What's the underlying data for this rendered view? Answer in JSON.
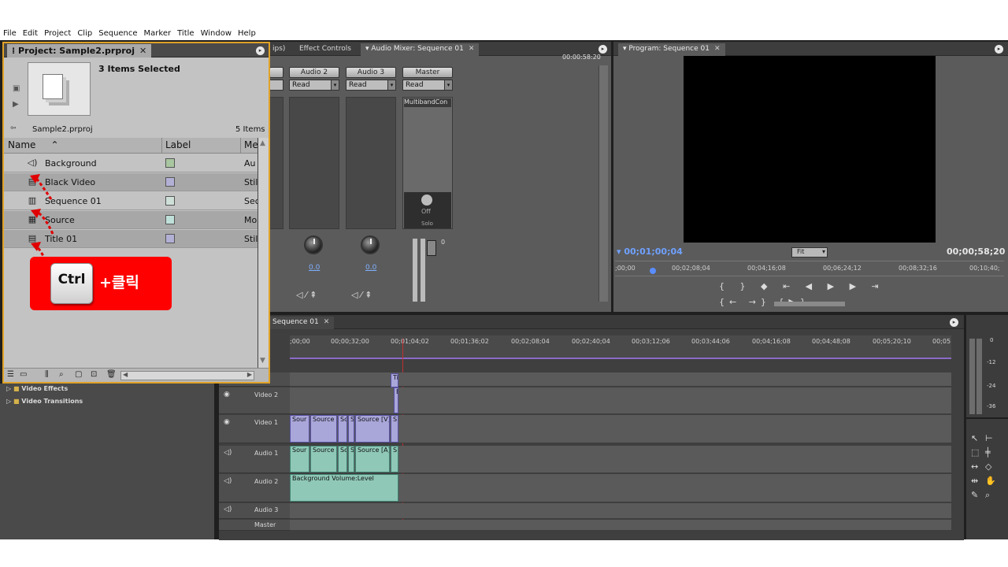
{
  "menu": [
    "File",
    "Edit",
    "Project",
    "Clip",
    "Sequence",
    "Marker",
    "Title",
    "Window",
    "Help"
  ],
  "project_panel": {
    "tab_label": "Project: Sample2.prproj",
    "selection_text": "3 Items Selected",
    "bin_name": "Sample2.prproj",
    "item_count": "5 Items",
    "col_name": "Name",
    "col_label": "Label",
    "col_media": "Me",
    "items": [
      {
        "name": "Background",
        "media": "Au",
        "icon": "audio-icon",
        "label_color": "#a8c6a0",
        "selected": false
      },
      {
        "name": "Black Video",
        "media": "Stil",
        "icon": "still-icon",
        "label_color": "#b3b0d6",
        "selected": true
      },
      {
        "name": "Sequence 01",
        "media": "Sec",
        "icon": "sequence-icon",
        "label_color": "#cfe0d9",
        "selected": false
      },
      {
        "name": "Source",
        "media": "Mo",
        "icon": "movie-icon",
        "label_color": "#bfe0d8",
        "selected": true
      },
      {
        "name": "Title 01",
        "media": "Stil",
        "icon": "title-icon",
        "label_color": "#b3b0d6",
        "selected": false
      }
    ]
  },
  "ctrl_callout": {
    "key": "Ctrl",
    "text": "+클릭",
    "color": "#ff0000"
  },
  "source_tabs": {
    "tab1": "ips)",
    "tab2": "Effect Controls",
    "tab3": "Audio Mixer: Sequence 01",
    "timecode": "00:00:58:20"
  },
  "audio_mixer": {
    "channels": [
      {
        "name": "Audio 2",
        "mode": "Read",
        "value": "0.0"
      },
      {
        "name": "Audio 3",
        "mode": "Read",
        "value": "0.0"
      },
      {
        "name": "Master",
        "mode": "Read",
        "fx": "MultibandCon",
        "off": "Off",
        "solo": "Solo",
        "meter_top": "0"
      }
    ]
  },
  "program_monitor": {
    "tab_label": "Program: Sequence 01",
    "current_time": "00;01;00;04",
    "fit": "Fit",
    "duration": "00;00;58;20",
    "ruler": [
      ";00;00",
      "00;02;08;04",
      "00;04;16;08",
      "00;06;24;12",
      "00;08;32;16",
      "00;10;40;"
    ]
  },
  "timeline": {
    "tab_label": "Sequence 01",
    "ruler": [
      ";00;00",
      "00;00;32;00",
      "00;01;04;02",
      "00;01;36;02",
      "00;02;08;04",
      "00;02;40;04",
      "00;03;12;06",
      "00;03;44;06",
      "00;04;16;08",
      "00;04;48;08",
      "00;05;20;10",
      "00;05"
    ],
    "tracks": [
      {
        "name": "Video 2",
        "type": "video"
      },
      {
        "name": "Video 1",
        "type": "video"
      },
      {
        "name": "Audio 1",
        "type": "audio"
      },
      {
        "name": "Audio 2",
        "type": "audio"
      },
      {
        "name": "Audio 3",
        "type": "audio"
      },
      {
        "name": "Master",
        "type": "audio"
      }
    ],
    "track3_label": "3",
    "video2_clips": [
      "Ti",
      "B"
    ],
    "video1_clips": [
      "Sour",
      "Source",
      "Sc",
      "S",
      "Source [V]",
      "S"
    ],
    "audio1_clips": [
      "Sour",
      "Source",
      "So",
      "S",
      "Source [A]",
      "S"
    ],
    "audio2_clip": "Background",
    "audio2_fx": "Volume:Level"
  },
  "effects_panel": {
    "items": [
      "Video Effects",
      "Video Transitions"
    ]
  },
  "audio_meter": {
    "labels": [
      "0",
      "-12",
      "-24",
      "-36"
    ]
  }
}
